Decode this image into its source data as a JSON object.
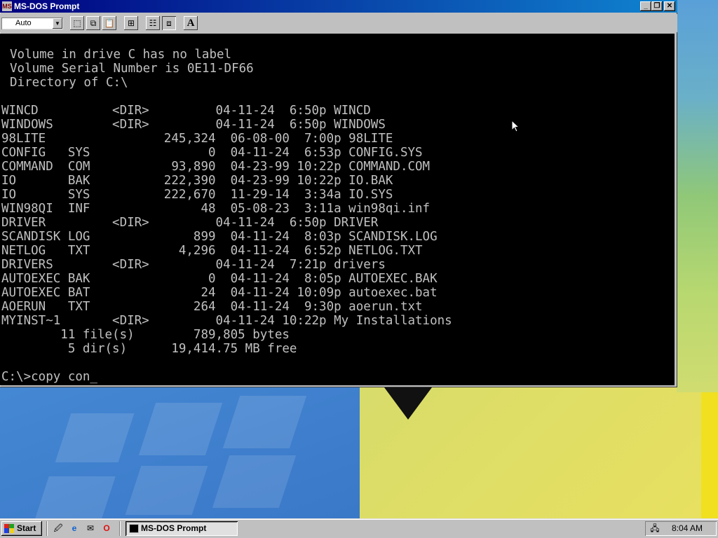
{
  "window": {
    "title": "MS-DOS Prompt",
    "title_icon": "MS",
    "minimize_glyph": "_",
    "restore_glyph": "❐",
    "close_glyph": "✕"
  },
  "toolbar": {
    "font_size_value": "Auto",
    "dropdown_glyph": "▼",
    "buttons": [
      {
        "name": "mark-icon",
        "glyph": "⬚"
      },
      {
        "name": "copy-icon",
        "glyph": "⧉"
      },
      {
        "name": "paste-icon",
        "glyph": "📋"
      },
      {
        "name": "fullscreen-icon",
        "glyph": "⊞"
      },
      {
        "name": "properties-icon",
        "glyph": "☷"
      },
      {
        "name": "background-icon",
        "glyph": "⧈"
      },
      {
        "name": "font-icon",
        "glyph": "A"
      }
    ]
  },
  "console": {
    "header_lines": [
      "Volume in drive C has no label",
      "Volume Serial Number is 0E11-DF66",
      "Directory of C:\\"
    ],
    "listing_lines": [
      "WINCD          <DIR>         04-11-24  6:50p WINCD",
      "WINDOWS        <DIR>         04-11-24  6:50p WINDOWS",
      "98LITE                245,324  06-08-00  7:00p 98LITE",
      "CONFIG   SYS                0  04-11-24  6:53p CONFIG.SYS",
      "COMMAND  COM           93,890  04-23-99 10:22p COMMAND.COM",
      "IO       BAK          222,390  04-23-99 10:22p IO.BAK",
      "IO       SYS          222,670  11-29-14  3:34a IO.SYS",
      "WIN98QI  INF               48  05-08-23  3:11a win98qi.inf",
      "DRIVER         <DIR>         04-11-24  6:50p DRIVER",
      "SCANDISK LOG              899  04-11-24  8:03p SCANDISK.LOG",
      "NETLOG   TXT            4,296  04-11-24  6:52p NETLOG.TXT",
      "DRIVERS        <DIR>         04-11-24  7:21p drivers",
      "AUTOEXEC BAK                0  04-11-24  8:05p AUTOEXEC.BAK",
      "AUTOEXEC BAT               24  04-11-24 10:09p autoexec.bat",
      "AOERUN   TXT              264  04-11-24  9:30p aoerun.txt",
      "MYINST~1       <DIR>         04-11-24 10:22p My Installations",
      "        11 file(s)        789,805 bytes",
      "         5 dir(s)      19,414.75 MB free"
    ],
    "prompt_line": "C:\\>copy con_"
  },
  "taskbar": {
    "start_label": "Start",
    "quick_launch": [
      {
        "name": "show-desktop-icon",
        "glyph": "🖉"
      },
      {
        "name": "internet-explorer-icon",
        "glyph": "e"
      },
      {
        "name": "outlook-express-icon",
        "glyph": "✉"
      },
      {
        "name": "opera-icon",
        "glyph": "O"
      }
    ],
    "task_button_label": "MS-DOS Prompt",
    "tray_icon": "🖧",
    "clock": "8:04 AM"
  }
}
